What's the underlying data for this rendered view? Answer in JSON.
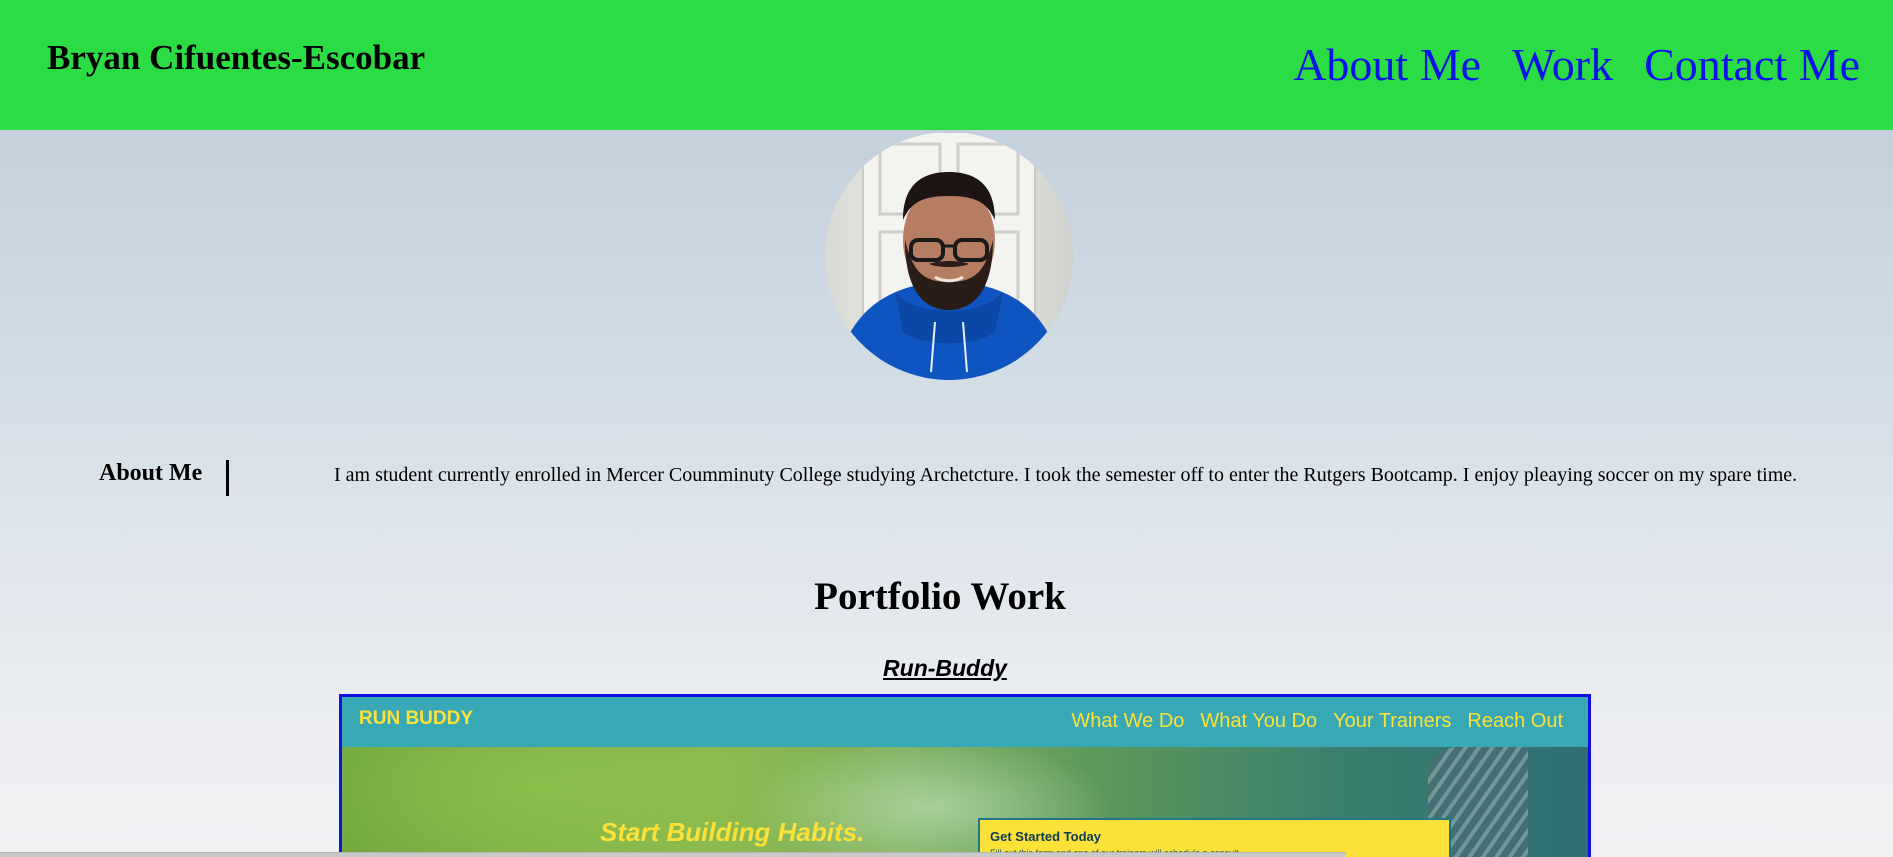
{
  "header": {
    "brand": "Bryan Cifuentes-Escobar",
    "nav": [
      "About Me",
      "Work",
      "Contact Me"
    ],
    "background_color": "#2bdc45",
    "link_color": "#0a14e8"
  },
  "profile": {
    "avatar_icon": "profile-photo"
  },
  "about": {
    "heading": "About Me",
    "text": "I am student currently enrolled in Mercer Coumminuty College studying Archetcture. I took the semester off to enter the Rutgers Bootcamp. I enjoy pleaying soccer on my spare time."
  },
  "portfolio": {
    "title": "Portfolio Work",
    "project": {
      "name": "Run-Buddy",
      "preview": {
        "brand": "RUN BUDDY",
        "nav": [
          "What We Do",
          "What You Do",
          "Your Trainers",
          "Reach Out"
        ],
        "tagline": "Start Building Habits.",
        "form_title": "Get Started Today",
        "form_subtitle": "Fill out this form and one of our trainers will schedule a consult.",
        "header_color": "#38a8b5",
        "accent_color": "#fce138"
      }
    }
  }
}
